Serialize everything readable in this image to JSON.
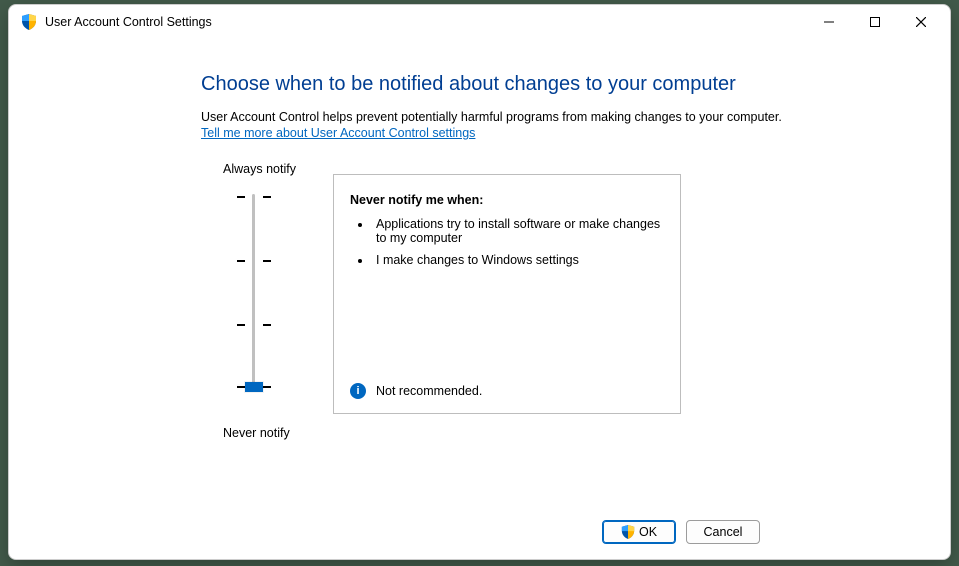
{
  "window": {
    "title": "User Account Control Settings"
  },
  "main": {
    "heading": "Choose when to be notified about changes to your computer",
    "description": "User Account Control helps prevent potentially harmful programs from making changes to your computer.",
    "help_link": "Tell me more about User Account Control settings"
  },
  "slider": {
    "label_top": "Always notify",
    "label_bottom": "Never notify",
    "levels": 4,
    "current_level": 0
  },
  "panel": {
    "title": "Never notify me when:",
    "bullets": [
      "Applications try to install software or make changes to my computer",
      "I make changes to Windows settings"
    ],
    "footer_text": "Not recommended."
  },
  "footer": {
    "ok_label": "OK",
    "cancel_label": "Cancel"
  }
}
